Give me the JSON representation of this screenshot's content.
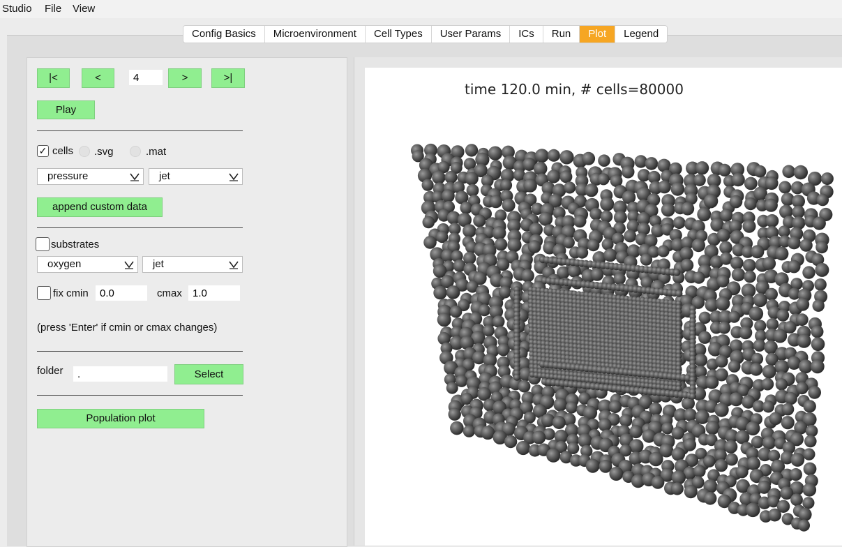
{
  "menu": {
    "items": [
      "Studio",
      "File",
      "View"
    ]
  },
  "tabs": [
    "Config Basics",
    "Microenvironment",
    "Cell Types",
    "User Params",
    "ICs",
    "Run",
    "Plot",
    "Legend"
  ],
  "active_tab": "Plot",
  "controls": {
    "first_label": "|<",
    "prev_label": "<",
    "frame_value": "4",
    "next_label": ">",
    "last_label": ">|",
    "play_label": "Play",
    "cells_label": "cells",
    "cells_checked": true,
    "svg_label": ".svg",
    "mat_label": ".mat",
    "cell_scalar": "pressure",
    "cell_cmap": "jet",
    "append_label": "append custom data",
    "substrates_label": "substrates",
    "substrates_checked": false,
    "substrate": "oxygen",
    "substrate_cmap": "jet",
    "fix_label": "fix",
    "cmin_label": "cmin",
    "cmin_value": "0.0",
    "cmax_label": "cmax",
    "cmax_value": "1.0",
    "hint": "(press 'Enter' if cmin or cmax changes)",
    "folder_label": "folder",
    "folder_value": ".",
    "select_label": "Select",
    "population_label": "Population plot"
  },
  "plot": {
    "title": "time 120.0 min, # cells=80000",
    "cell_color": "#555555"
  }
}
